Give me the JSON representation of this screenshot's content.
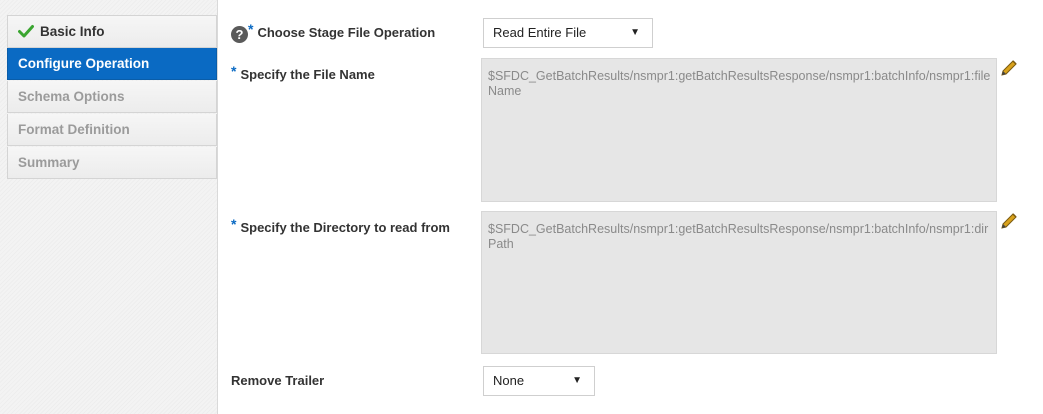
{
  "sidebar": {
    "items": [
      {
        "label": "Basic Info",
        "state": "completed",
        "icon": "checkmark-icon"
      },
      {
        "label": "Configure Operation",
        "state": "active"
      },
      {
        "label": "Schema Options",
        "state": "disabled"
      },
      {
        "label": "Format Definition",
        "state": "disabled"
      },
      {
        "label": "Summary",
        "state": "disabled"
      }
    ]
  },
  "form": {
    "operation": {
      "label": "Choose Stage File Operation",
      "required_marker": "*",
      "help_icon": "question-circle-icon",
      "value": "Read Entire File"
    },
    "file_name": {
      "label": "Specify the File Name",
      "required_marker": "*",
      "value": "$SFDC_GetBatchResults/nsmpr1:getBatchResultsResponse/nsmpr1:batchInfo/nsmpr1:fileName",
      "edit_icon": "pencil-icon"
    },
    "directory": {
      "label": "Specify the Directory to read from",
      "required_marker": "*",
      "value": "$SFDC_GetBatchResults/nsmpr1:getBatchResultsResponse/nsmpr1:batchInfo/nsmpr1:dirPath",
      "edit_icon": "pencil-icon"
    },
    "remove_trailer": {
      "label": "Remove Trailer",
      "value": "None"
    }
  },
  "colors": {
    "accent": "#0a6ac3",
    "check": "#3aa530",
    "pencil": "#d9a21b"
  }
}
